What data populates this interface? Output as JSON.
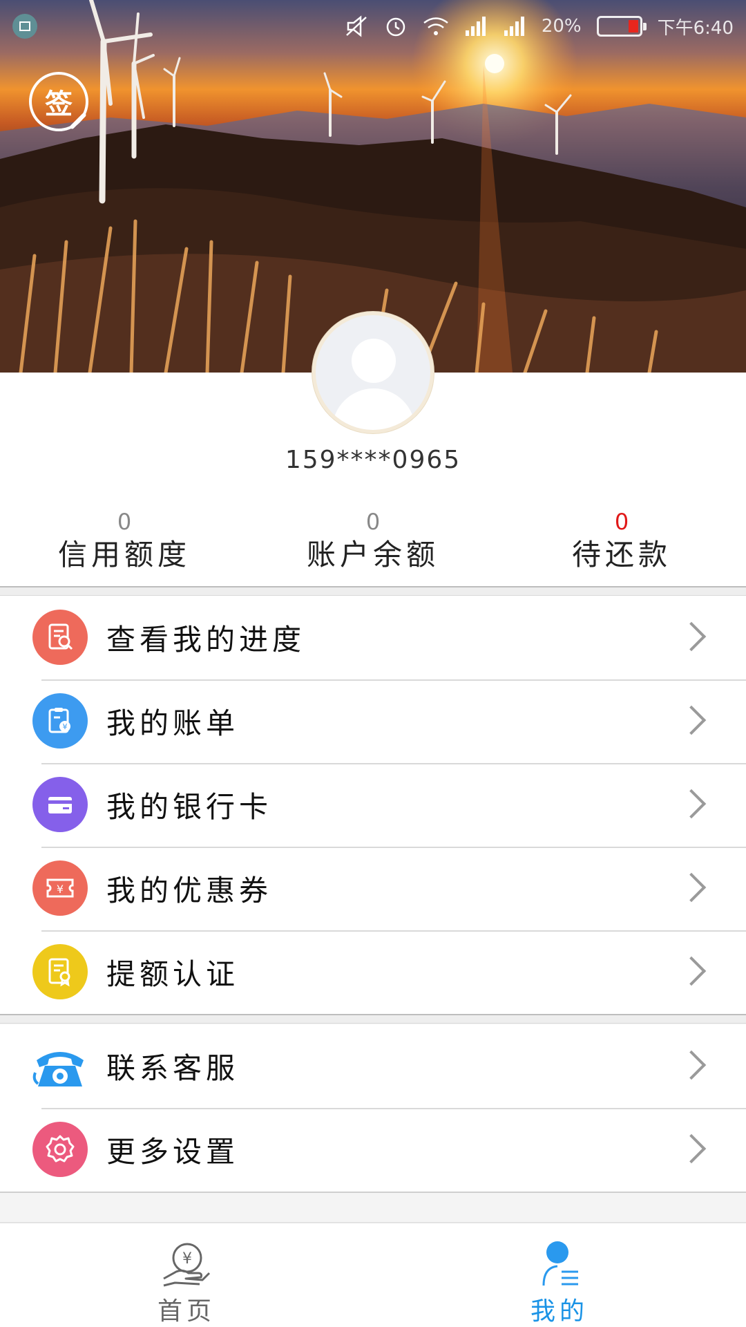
{
  "status_bar": {
    "battery": "20%",
    "time": "下午6:40",
    "icons": [
      "screenshot-icon",
      "mute-icon",
      "alarm-icon",
      "wifi-icon",
      "signal-icon",
      "signal-icon",
      "battery-icon"
    ]
  },
  "header": {
    "signin_label": "签"
  },
  "profile": {
    "phone": "159****0965",
    "stats": [
      {
        "value": "0",
        "label": "信用额度"
      },
      {
        "value": "0",
        "label": "账户余额"
      },
      {
        "value": "0",
        "label": "待还款"
      }
    ]
  },
  "menu_primary": [
    {
      "label": "查看我的进度",
      "icon": "progress-icon",
      "color": "#ee6a5b"
    },
    {
      "label": "我的账单",
      "icon": "bill-icon",
      "color": "#3d9bf0"
    },
    {
      "label": "我的银行卡",
      "icon": "bank-card-icon",
      "color": "#8560ea"
    },
    {
      "label": "我的优惠券",
      "icon": "coupon-icon",
      "color": "#ee6a5b"
    },
    {
      "label": "提额认证",
      "icon": "credit-certify-icon",
      "color": "#eec91b"
    }
  ],
  "menu_secondary": [
    {
      "label": "联系客服",
      "icon": "phone-icon",
      "color": "#2a99ee"
    },
    {
      "label": "更多设置",
      "icon": "settings-icon",
      "color": "#ec5a7e"
    }
  ],
  "tabs": [
    {
      "label": "首页",
      "icon": "home-money-icon",
      "active": false
    },
    {
      "label": "我的",
      "icon": "profile-icon",
      "active": true
    }
  ],
  "colors": {
    "accent": "#1a93e6",
    "danger": "#e01818"
  }
}
